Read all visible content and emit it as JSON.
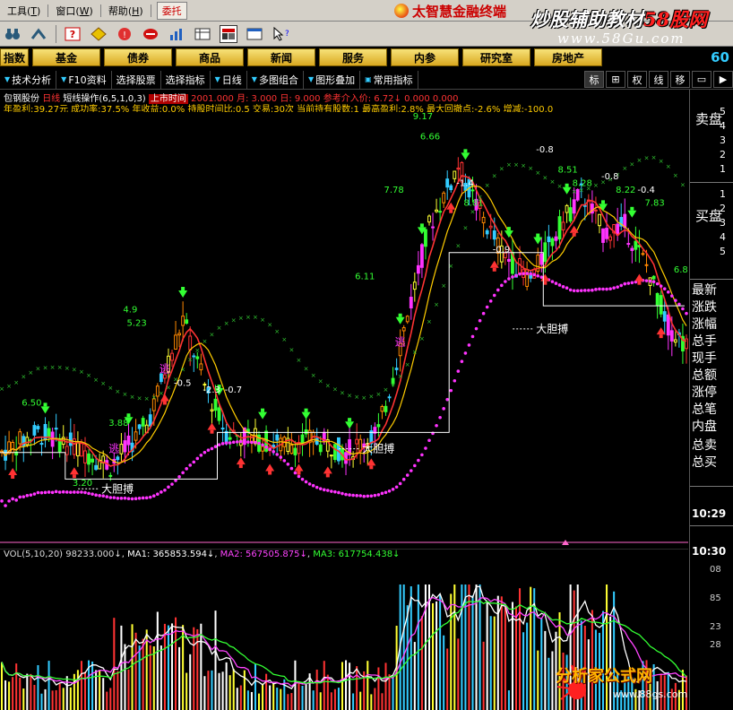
{
  "menu": {
    "items": [
      {
        "label": "工具",
        "key": "T"
      },
      {
        "label": "窗口",
        "key": "W"
      },
      {
        "label": "帮助",
        "key": "H"
      }
    ],
    "tab": "委托",
    "brand": "太智慧金融终端"
  },
  "watermark": {
    "top_title": "炒股辅助教材",
    "top_red": "58股网",
    "top_url": "www.58Gu.com",
    "bottom_title": "分析家公式网",
    "bottom_url": "www.88gs.com"
  },
  "categories": [
    "指数",
    "基金",
    "债券",
    "商品",
    "新闻",
    "服务",
    "内参",
    "研究室",
    "房地产"
  ],
  "tickerbar_right": "60",
  "subbar": {
    "items": [
      "技术分析",
      "F10资料",
      "选择股票",
      "选择指标",
      "日线",
      "多图组合",
      "图形叠加",
      "常用指标"
    ],
    "right": [
      "标",
      "权",
      "线",
      "移"
    ]
  },
  "info": {
    "stock": "包钢股份",
    "period": "日线",
    "indicator": "短线操作(6,5,1,0,3)",
    "tag": "上市时间",
    "line1_rest": "2001.000  月: 3.000  日: 9.000  参考介入价: 6.72↓  0.000  0.000",
    "line2": "年盈利:39.27元 成功率:37.5% 年收益:0.0% 持股时间比:0.5 交易:30次 当前持有股数:1 最高盈利:2.8%  最大回撤点:-2.6% 增减:-100.0"
  },
  "right_panel": {
    "sell_label": "卖盘",
    "buy_label": "买盘",
    "sell_levels": [
      "5",
      "4",
      "3",
      "2",
      "1"
    ],
    "buy_levels": [
      "1",
      "2",
      "3",
      "4",
      "5"
    ],
    "fields": [
      "最新",
      "涨跌",
      "涨幅",
      "总手",
      "现手",
      "总额",
      "涨停",
      "总笔",
      "内盘",
      "总卖",
      "总买"
    ],
    "times": [
      "10:29",
      "10:30"
    ],
    "vol_ticks": [
      "08",
      "85",
      "23",
      "28"
    ]
  },
  "volume": {
    "label": "VOL(5,10,20)",
    "vol": "98233.000↓",
    "ma1": "MA1: 365853.594↓",
    "ma2": "MA2: 567505.875↓",
    "ma3": "MA3: 617754.438↓"
  },
  "annotations": {
    "texts": [
      "大胆搏",
      "大胆搏",
      "大胆搏",
      "逃",
      "逃",
      "逃"
    ],
    "prices": [
      "6.50",
      "3.20",
      "4.9",
      "5.23",
      "-0.5",
      "-2.3",
      "-0.7",
      "9.17",
      "6.66",
      "7.78",
      "6.11",
      "-1.4",
      "8.81",
      "-0.9",
      "-0.8",
      "8.51",
      "8.28",
      "-0.8",
      "8.22",
      "-0.4",
      "7.83",
      "6.8",
      "3.88"
    ]
  }
}
